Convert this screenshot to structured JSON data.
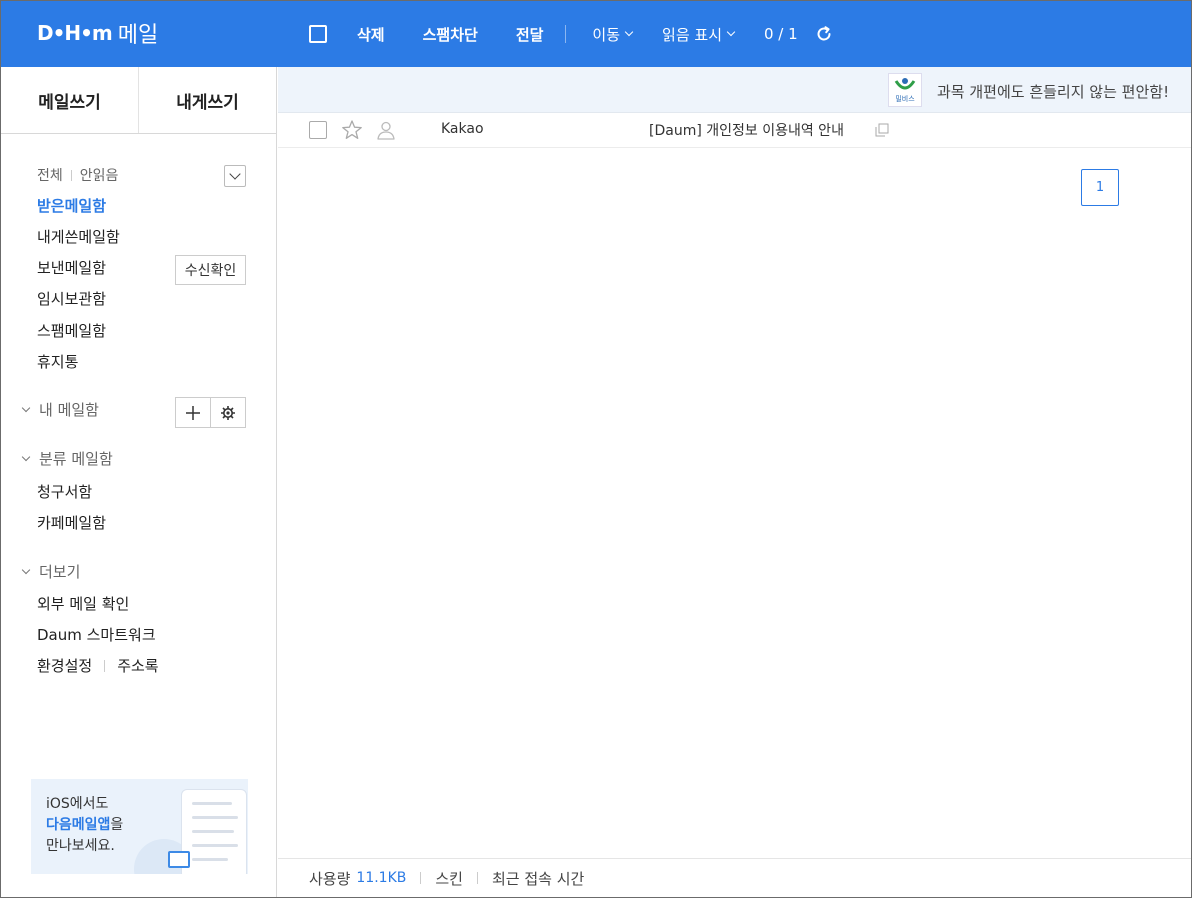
{
  "brand": {
    "logo_mark": "D•H•m",
    "logo_text": "메일"
  },
  "toolbar": {
    "delete_label": "삭제",
    "spam_label": "스팸차단",
    "forward_label": "전달",
    "move_label": "이동",
    "mark_read_label": "읽음 표시",
    "count": "0 / 1"
  },
  "compose": {
    "write_label": "메일쓰기",
    "write_to_self_label": "내게쓰기"
  },
  "filter": {
    "all_label": "전체",
    "unread_label": "안읽음"
  },
  "folders": {
    "inbox": "받은메일함",
    "to_self": "내게쓴메일함",
    "sent": "보낸메일함",
    "drafts": "임시보관함",
    "spam": "스팸메일함",
    "trash": "휴지통"
  },
  "receipt_button": "수신확인",
  "my_mailboxes": {
    "title": "내 메일함"
  },
  "categories": {
    "title": "분류 메일함",
    "items": [
      "청구서함",
      "카페메일함"
    ]
  },
  "more": {
    "title": "더보기",
    "items": [
      "외부 메일 확인",
      "Daum 스마트워크"
    ],
    "settings": "환경설정",
    "address_book": "주소록"
  },
  "promo": {
    "line1": "iOS에서도",
    "highlight": "다음메일앱",
    "suffix": "을",
    "line3": "만나보세요."
  },
  "ad": {
    "logo_label": "밀비스",
    "text": "과목 개편에도 흔들리지 않는 편안함!"
  },
  "mails": [
    {
      "sender": "Kakao",
      "subject": "[Daum] 개인정보 이용내역 안내"
    }
  ],
  "pagination": {
    "current": "1"
  },
  "footer": {
    "usage_label": "사용량",
    "usage_value": "11.1KB",
    "skin": "스킨",
    "last_login": "최근 접속 시간"
  },
  "colors": {
    "accent": "#2c7be5",
    "header_bg": "#2c7be5",
    "ad_bg": "#eef4fb"
  }
}
